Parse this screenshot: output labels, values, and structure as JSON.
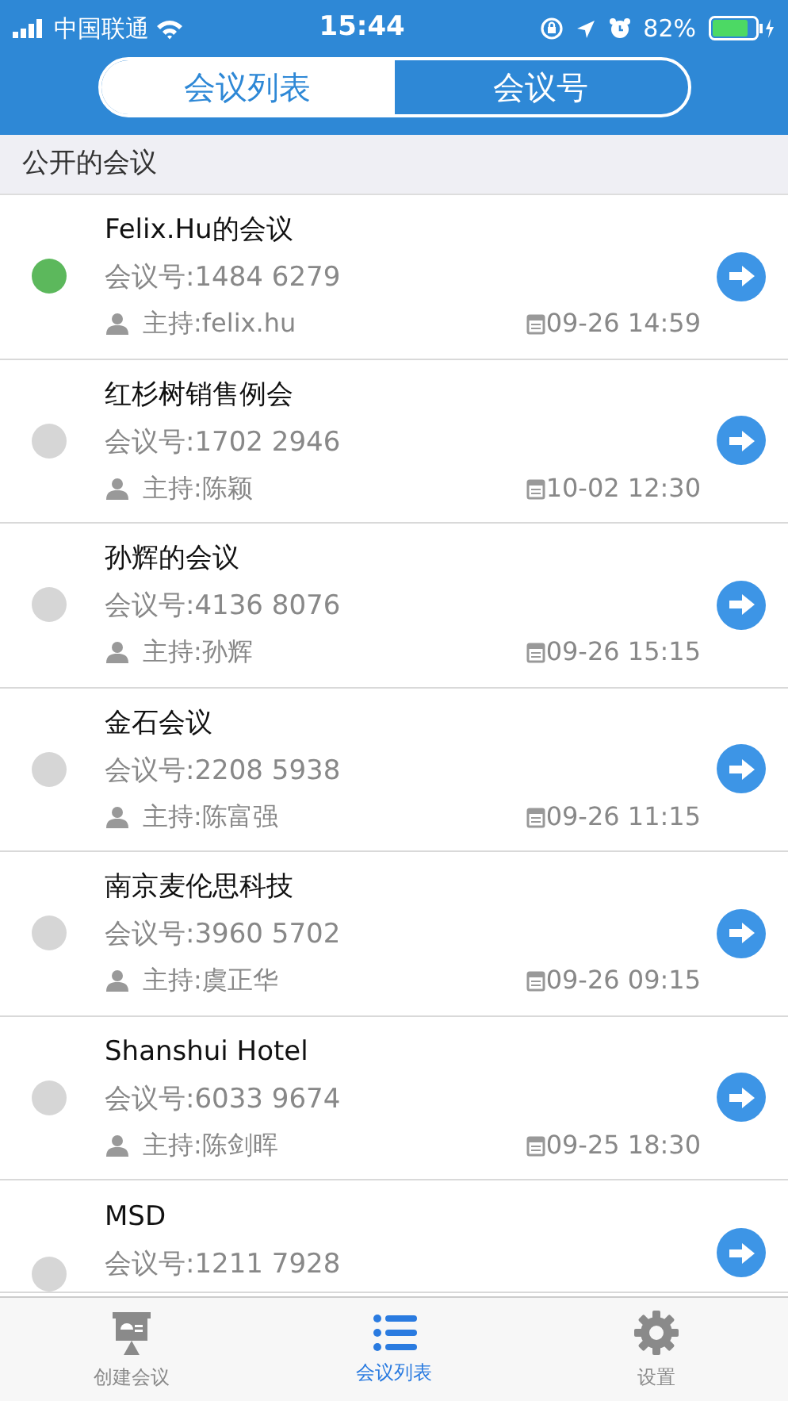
{
  "status_bar": {
    "carrier": "中国联通",
    "time": "15:44",
    "battery": "82%"
  },
  "segments": [
    {
      "label": "会议列表",
      "selected": true
    },
    {
      "label": "会议号",
      "selected": false
    }
  ],
  "section_title": "公开的会议",
  "meetings": [
    {
      "title": "Felix.Hu的会议",
      "number": "会议号:1484 6279",
      "host": "主持:felix.hu",
      "date": "09-26 14:59",
      "active": true
    },
    {
      "title": "红杉树销售例会",
      "number": "会议号:1702 2946",
      "host": "主持:陈颖",
      "date": "10-02 12:30",
      "active": false
    },
    {
      "title": "孙辉的会议",
      "number": "会议号:4136 8076",
      "host": "主持:孙辉",
      "date": "09-26 15:15",
      "active": false
    },
    {
      "title": "金石会议",
      "number": "会议号:2208 5938",
      "host": "主持:陈富强",
      "date": "09-26 11:15",
      "active": false
    },
    {
      "title": "南京麦伦思科技",
      "number": "会议号:3960 5702",
      "host": "主持:虞正华",
      "date": "09-26 09:15",
      "active": false
    },
    {
      "title": "Shanshui Hotel",
      "number": "会议号:6033 9674",
      "host": "主持:陈剑晖",
      "date": "09-25 18:30",
      "active": false
    },
    {
      "title": "MSD",
      "number": "会议号:1211 7928",
      "active": false
    }
  ],
  "tab_bar": [
    {
      "label": "创建会议",
      "kind": "create",
      "selected": false
    },
    {
      "label": "会议列表",
      "kind": "list",
      "selected": true
    },
    {
      "label": "设置",
      "kind": "settings",
      "selected": false
    }
  ]
}
